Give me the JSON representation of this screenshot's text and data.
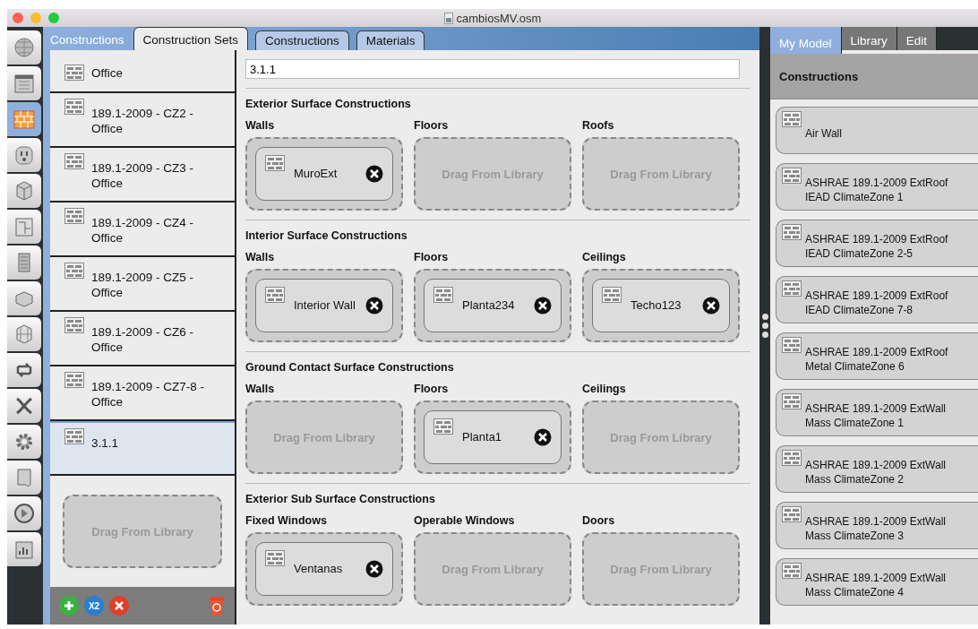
{
  "window": {
    "title": "cambiosMV.osm"
  },
  "nav": [
    {
      "selected": false
    },
    {
      "selected": false
    },
    {
      "selected": true
    },
    {
      "selected": false
    },
    {
      "selected": false
    },
    {
      "selected": false
    },
    {
      "selected": false
    },
    {
      "selected": false
    },
    {
      "selected": false
    },
    {
      "selected": false
    },
    {
      "selected": false
    },
    {
      "selected": false
    },
    {
      "selected": false
    },
    {
      "selected": false
    },
    {
      "selected": false
    }
  ],
  "main": {
    "title": "Constructions",
    "tabs": [
      {
        "label": "Construction Sets",
        "selected": true
      },
      {
        "label": "Constructions",
        "selected": false
      },
      {
        "label": "Materials",
        "selected": false
      }
    ]
  },
  "sets": [
    {
      "name": "Office",
      "selected": false
    },
    {
      "name": "189.1-2009 - CZ2 - Office",
      "selected": false
    },
    {
      "name": "189.1-2009 - CZ3 - Office",
      "selected": false
    },
    {
      "name": "189.1-2009 - CZ4 - Office",
      "selected": false
    },
    {
      "name": "189.1-2009 - CZ5 - Office",
      "selected": false
    },
    {
      "name": "189.1-2009 - CZ6 - Office",
      "selected": false
    },
    {
      "name": "189.1-2009 - CZ7-8 - Office",
      "selected": false
    },
    {
      "name": "3.1.1",
      "selected": true
    }
  ],
  "sets_drop": "Drag From Library",
  "duplicate_label": "X2",
  "name_value": "3.1.1",
  "sections": [
    {
      "title": "Exterior Surface Constructions",
      "slots": [
        {
          "label": "Walls",
          "kind": "item",
          "name": "MuroExt"
        },
        {
          "label": "Floors",
          "kind": "empty",
          "name": "Drag From Library"
        },
        {
          "label": "Roofs",
          "kind": "empty",
          "name": "Drag From Library"
        }
      ]
    },
    {
      "title": "Interior Surface Constructions",
      "slots": [
        {
          "label": "Walls",
          "kind": "item",
          "name": "Interior Wall"
        },
        {
          "label": "Floors",
          "kind": "item",
          "name": "Planta234"
        },
        {
          "label": "Ceilings",
          "kind": "item",
          "name": "Techo123"
        }
      ]
    },
    {
      "title": "Ground Contact Surface Constructions",
      "slots": [
        {
          "label": "Walls",
          "kind": "empty",
          "name": "Drag From Library"
        },
        {
          "label": "Floors",
          "kind": "item",
          "name": "Planta1"
        },
        {
          "label": "Ceilings",
          "kind": "empty",
          "name": "Drag From Library"
        }
      ]
    },
    {
      "title": "Exterior Sub Surface Constructions",
      "slots": [
        {
          "label": "Fixed Windows",
          "kind": "item",
          "name": "Ventanas"
        },
        {
          "label": "Operable Windows",
          "kind": "empty",
          "name": "Drag From Library"
        },
        {
          "label": "Doors",
          "kind": "empty",
          "name": "Drag From Library"
        }
      ]
    }
  ],
  "right": {
    "tabs": [
      {
        "label": "My Model",
        "selected": true
      },
      {
        "label": "Library",
        "selected": false
      },
      {
        "label": "Edit",
        "selected": false
      }
    ],
    "header": "Constructions",
    "items": [
      "Air Wall",
      "ASHRAE 189.1-2009 ExtRoof IEAD ClimateZone 1",
      "ASHRAE 189.1-2009 ExtRoof IEAD ClimateZone 2-5",
      "ASHRAE 189.1-2009 ExtRoof IEAD ClimateZone 7-8",
      "ASHRAE 189.1-2009 ExtRoof Metal ClimateZone 6",
      "ASHRAE 189.1-2009 ExtWall Mass ClimateZone 1",
      "ASHRAE 189.1-2009 ExtWall Mass ClimateZone 2",
      "ASHRAE 189.1-2009 ExtWall Mass ClimateZone 3",
      "ASHRAE 189.1-2009 ExtWall Mass ClimateZone 4"
    ]
  }
}
